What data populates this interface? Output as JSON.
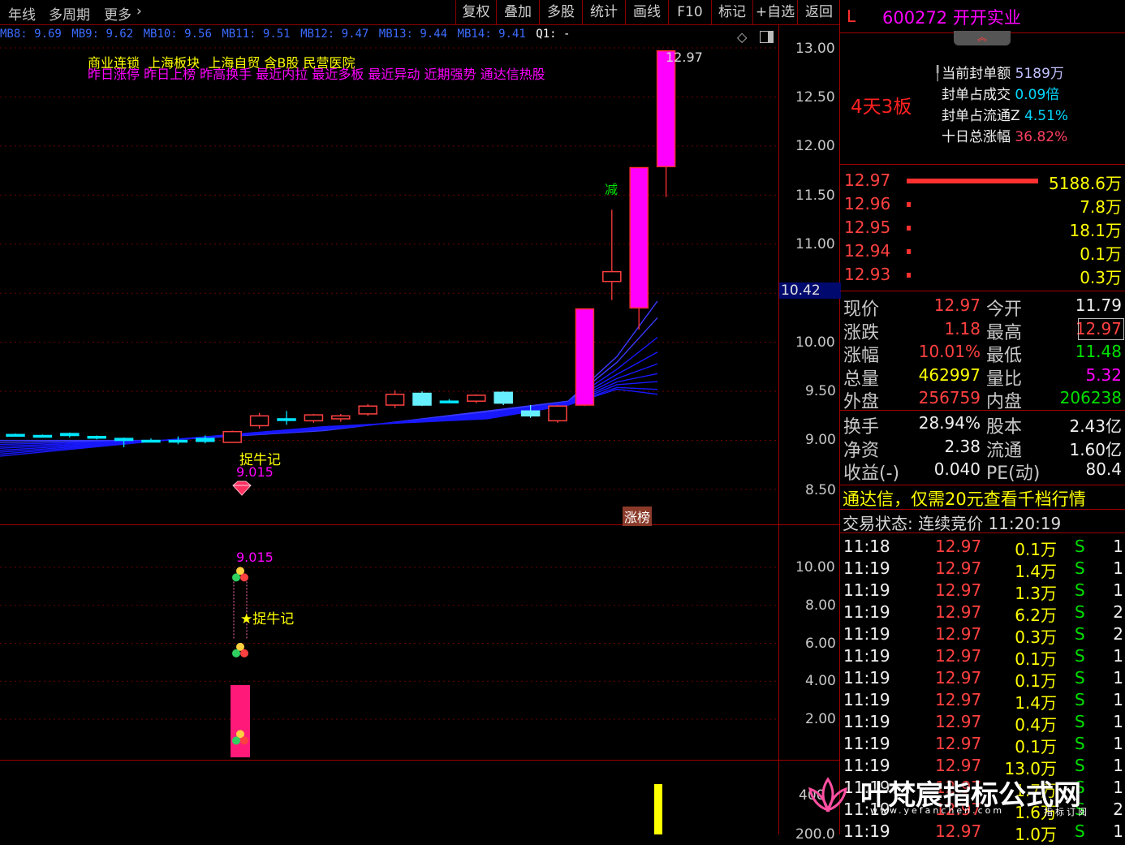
{
  "toolbar": {
    "left_items": [
      "年线",
      "多周期",
      "更多"
    ],
    "buttons": [
      "复权",
      "叠加",
      "多股",
      "统计",
      "画线",
      "F10",
      "标记",
      "+自选",
      "返回"
    ]
  },
  "mb_values": [
    "MB8: 9.69",
    "MB9: 9.62",
    "MB10: 9.56",
    "MB11: 9.51",
    "MB12: 9.47",
    "MB13: 9.44",
    "MB14: 9.41",
    "Q1: -"
  ],
  "tags": {
    "line1": "商业连锁  上海板块  上海自贸 含B股 民营医院",
    "line2": "昨日涨停 昨日上榜 昨高换手 最近内拉 最近多板 最近异动 近期强势 通达信热股"
  },
  "price_axis": [
    "13.00",
    "12.50",
    "12.00",
    "11.50",
    "11.00",
    "10.42",
    "10.00",
    "9.50",
    "9.00",
    "8.50"
  ],
  "lower_axis": [
    "10.00",
    "8.00",
    "6.00",
    "4.00",
    "2.00"
  ],
  "bottom_axis": [
    "400",
    "200.0"
  ],
  "annotations": {
    "high_price": "12.97",
    "jian_label": "减",
    "zhuoniuji": "捉牛记",
    "low_price": "9.015",
    "zhangbang": "涨榜",
    "lower_price": "9.015",
    "lower_star_label": "★捉牛记"
  },
  "header": {
    "market": "L",
    "code_name": "600272 开开实业"
  },
  "limit_info": {
    "streak": "4天3板",
    "rows": [
      {
        "label": "当前封单额",
        "value": "5189万"
      },
      {
        "label": "封单占成交",
        "value": "0.09倍"
      },
      {
        "label": "封单占流通Z",
        "value": "4.51%"
      },
      {
        "label": "十日总涨幅",
        "value": "36.82%"
      }
    ]
  },
  "order_book": [
    {
      "price": "12.97",
      "vol": "5188.6万",
      "bar": 1.0
    },
    {
      "price": "12.96",
      "vol": "7.8万",
      "bar": 0.02
    },
    {
      "price": "12.95",
      "vol": "18.1万",
      "bar": 0.03
    },
    {
      "price": "12.94",
      "vol": "0.1万",
      "bar": 0.02
    },
    {
      "price": "12.93",
      "vol": "0.3万",
      "bar": 0.02
    }
  ],
  "quote": [
    {
      "l1": "现价",
      "v1": "12.97",
      "l2": "今开",
      "v2": "11.79"
    },
    {
      "l1": "涨跌",
      "v1": "1.18",
      "l2": "最高",
      "v2": "12.97"
    },
    {
      "l1": "涨幅",
      "v1": "10.01%",
      "l2": "最低",
      "v2": "11.48"
    },
    {
      "l1": "总量",
      "v1": "462997",
      "l2": "量比",
      "v2": "5.32"
    },
    {
      "l1": "外盘",
      "v1": "256759",
      "l2": "内盘",
      "v2": "206238"
    }
  ],
  "quote2": [
    {
      "l1": "换手",
      "v1": "28.94%",
      "l2": "股本",
      "v2": "2.43亿"
    },
    {
      "l1": "净资",
      "v1": "2.38",
      "l2": "流通",
      "v2": "1.60亿"
    },
    {
      "l1": "收益(-)",
      "v1": "0.040",
      "l2": "PE(动)",
      "v2": "80.4"
    }
  ],
  "promo": "通达信，仅需20元查看千档行情",
  "trade_status": "交易状态: 连续竞价 11:20:19",
  "ticks": [
    {
      "t": "11:18",
      "p": "12.97",
      "v": "0.1万",
      "s": "S",
      "n": "1"
    },
    {
      "t": "11:19",
      "p": "12.97",
      "v": "1.4万",
      "s": "S",
      "n": "1"
    },
    {
      "t": "11:19",
      "p": "12.97",
      "v": "1.3万",
      "s": "S",
      "n": "1"
    },
    {
      "t": "11:19",
      "p": "12.97",
      "v": "6.2万",
      "s": "S",
      "n": "2"
    },
    {
      "t": "11:19",
      "p": "12.97",
      "v": "0.3万",
      "s": "S",
      "n": "2"
    },
    {
      "t": "11:19",
      "p": "12.97",
      "v": "0.1万",
      "s": "S",
      "n": "1"
    },
    {
      "t": "11:19",
      "p": "12.97",
      "v": "0.1万",
      "s": "S",
      "n": "1"
    },
    {
      "t": "11:19",
      "p": "12.97",
      "v": "1.4万",
      "s": "S",
      "n": "1"
    },
    {
      "t": "11:19",
      "p": "12.97",
      "v": "0.4万",
      "s": "S",
      "n": "1"
    },
    {
      "t": "11:19",
      "p": "12.97",
      "v": "0.1万",
      "s": "S",
      "n": "1"
    },
    {
      "t": "11:19",
      "p": "12.97",
      "v": "13.0万",
      "s": "S",
      "n": "1"
    },
    {
      "t": "11:19",
      "p": "12.97",
      "v": "1.7万",
      "s": "S",
      "n": "1"
    },
    {
      "t": "11:19",
      "p": "12.97",
      "v": "1.6万",
      "s": "S",
      "n": "2"
    },
    {
      "t": "11:19",
      "p": "12.97",
      "v": "1.0万",
      "s": "S",
      "n": "1"
    }
  ],
  "watermark": {
    "title": "叶梵宸指标公式网",
    "url": "www.yefanchen.com",
    "sub": "指标订阅"
  },
  "candles": [
    {
      "o": 9.05,
      "h": 9.07,
      "l": 9.04,
      "c": 9.06,
      "color": "cyan"
    },
    {
      "o": 9.04,
      "h": 9.06,
      "l": 9.03,
      "c": 9.05,
      "color": "cyan"
    },
    {
      "o": 9.05,
      "h": 9.08,
      "l": 9.03,
      "c": 9.07,
      "color": "cyan"
    },
    {
      "o": 9.03,
      "h": 9.05,
      "l": 9.01,
      "c": 9.04,
      "color": "cyan"
    },
    {
      "o": 9.0,
      "h": 9.03,
      "l": 8.93,
      "c": 9.02,
      "color": "cyan"
    },
    {
      "o": 9.0,
      "h": 9.02,
      "l": 8.98,
      "c": 8.99,
      "color": "cyan"
    },
    {
      "o": 9.0,
      "h": 9.04,
      "l": 8.96,
      "c": 9.0,
      "color": "cyan"
    },
    {
      "o": 8.99,
      "h": 9.05,
      "l": 8.97,
      "c": 9.02,
      "color": "cyan"
    },
    {
      "o": 8.98,
      "h": 9.1,
      "l": 8.98,
      "c": 9.09,
      "color": "red"
    },
    {
      "o": 9.15,
      "h": 9.28,
      "l": 9.12,
      "c": 9.25,
      "color": "red"
    },
    {
      "o": 9.22,
      "h": 9.3,
      "l": 9.16,
      "c": 9.22,
      "color": "cyan"
    },
    {
      "o": 9.2,
      "h": 9.27,
      "l": 9.18,
      "c": 9.26,
      "color": "red"
    },
    {
      "o": 9.22,
      "h": 9.27,
      "l": 9.19,
      "c": 9.25,
      "color": "red"
    },
    {
      "o": 9.27,
      "h": 9.37,
      "l": 9.25,
      "c": 9.35,
      "color": "red"
    },
    {
      "o": 9.36,
      "h": 9.51,
      "l": 9.33,
      "c": 9.47,
      "color": "red"
    },
    {
      "o": 9.36,
      "h": 9.5,
      "l": 9.35,
      "c": 9.48,
      "color": "cyanfill"
    },
    {
      "o": 9.4,
      "h": 9.42,
      "l": 9.38,
      "c": 9.4,
      "color": "cyan"
    },
    {
      "o": 9.4,
      "h": 9.47,
      "l": 9.38,
      "c": 9.46,
      "color": "red"
    },
    {
      "o": 9.38,
      "h": 9.5,
      "l": 9.36,
      "c": 9.49,
      "color": "cyanfill"
    },
    {
      "o": 9.3,
      "h": 9.36,
      "l": 9.23,
      "c": 9.25,
      "color": "cyanfill"
    },
    {
      "o": 9.2,
      "h": 9.36,
      "l": 9.18,
      "c": 9.35,
      "color": "red"
    },
    {
      "o": 9.36,
      "h": 10.34,
      "l": 9.35,
      "c": 10.34,
      "color": "magenta"
    },
    {
      "o": 10.62,
      "h": 11.35,
      "l": 10.43,
      "c": 10.72,
      "color": "red"
    },
    {
      "o": 10.35,
      "h": 11.78,
      "l": 10.13,
      "c": 11.78,
      "color": "magenta"
    },
    {
      "o": 11.79,
      "h": 12.97,
      "l": 11.48,
      "c": 12.97,
      "color": "magenta"
    }
  ]
}
